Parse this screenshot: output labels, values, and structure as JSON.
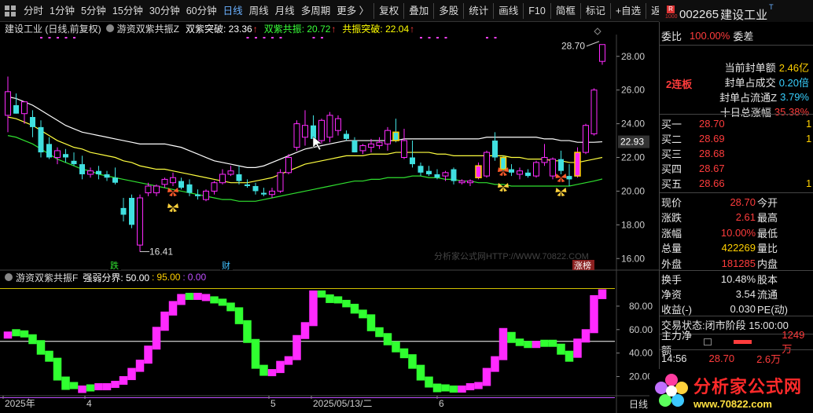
{
  "toolbar": {
    "periods": [
      "分时",
      "1分钟",
      "5分钟",
      "15分钟",
      "30分钟",
      "60分钟",
      "日线",
      "周线",
      "月线",
      "多周期",
      "更多 〉"
    ],
    "active_period": "日线",
    "tools": [
      "复权",
      "叠加",
      "多股",
      "统计",
      "画线",
      "F10",
      "简框",
      "标记",
      "+自选",
      "返回"
    ]
  },
  "stock": {
    "code": "002265",
    "name": "建设工业",
    "suffix": "T"
  },
  "price_header": {
    "title": "建设工业 (日线,前复权)",
    "indicator": "游资双紫共振Z",
    "items": [
      {
        "label": "双紫突破: 23.36",
        "color": "#ffffff"
      },
      {
        "label": "双紫共振: 20.72",
        "color": "#39ff39"
      },
      {
        "label": "共振突破: 22.04",
        "color": "#ffff00"
      }
    ]
  },
  "indicator_header": {
    "name": "游资双紫共振F",
    "label": "强弱分界: 50.00",
    "v2": "95.00",
    "v3": "0.00"
  },
  "chart_data": {
    "type": "candlestick",
    "y_axis_price": [
      16.0,
      18.0,
      20.0,
      22.0,
      24.0,
      26.0,
      28.0
    ],
    "current_price_label": "22.93",
    "high_label": "28.70",
    "low_label": "16.41",
    "ylim": [
      15.5,
      29.2
    ],
    "candles": [
      {
        "o": 24.5,
        "h": 26.8,
        "l": 23.5,
        "c": 25.9
      },
      {
        "o": 25.1,
        "h": 25.8,
        "l": 24.6,
        "c": 24.6
      },
      {
        "o": 24.6,
        "h": 25.3,
        "l": 24.0,
        "c": 25.3
      },
      {
        "o": 24.4,
        "h": 24.8,
        "l": 23.2,
        "c": 23.8
      },
      {
        "o": 23.8,
        "h": 24.2,
        "l": 22.0,
        "c": 22.3
      },
      {
        "o": 22.8,
        "h": 23.2,
        "l": 21.9,
        "c": 22.0
      },
      {
        "o": 22.0,
        "h": 22.6,
        "l": 21.6,
        "c": 22.4
      },
      {
        "o": 22.2,
        "h": 22.5,
        "l": 21.7,
        "c": 22.0
      },
      {
        "o": 21.8,
        "h": 22.3,
        "l": 21.5,
        "c": 21.6
      },
      {
        "o": 21.6,
        "h": 22.1,
        "l": 20.7,
        "c": 21.0
      },
      {
        "o": 21.0,
        "h": 21.4,
        "l": 20.8,
        "c": 21.2
      },
      {
        "o": 21.2,
        "h": 21.5,
        "l": 20.7,
        "c": 21.0
      },
      {
        "o": 21.0,
        "h": 21.2,
        "l": 20.6,
        "c": 20.8
      },
      {
        "o": 20.8,
        "h": 21.4,
        "l": 20.4,
        "c": 20.5
      },
      {
        "o": 19.0,
        "h": 19.6,
        "l": 18.2,
        "c": 18.6
      },
      {
        "o": 19.6,
        "h": 19.8,
        "l": 17.8,
        "c": 18.0
      },
      {
        "o": 16.8,
        "h": 19.8,
        "l": 16.4,
        "c": 19.6
      },
      {
        "o": 19.9,
        "h": 20.5,
        "l": 19.7,
        "c": 20.3
      },
      {
        "o": 19.9,
        "h": 20.4,
        "l": 19.7,
        "c": 20.3
      },
      {
        "o": 20.4,
        "h": 20.8,
        "l": 20.2,
        "c": 20.7
      },
      {
        "o": 20.5,
        "h": 21.1,
        "l": 20.3,
        "c": 20.8
      },
      {
        "o": 20.6,
        "h": 20.8,
        "l": 20.1,
        "c": 20.2
      },
      {
        "o": 20.4,
        "h": 20.7,
        "l": 19.7,
        "c": 19.9
      },
      {
        "o": 19.8,
        "h": 20.1,
        "l": 19.5,
        "c": 19.7
      },
      {
        "o": 19.5,
        "h": 20.1,
        "l": 19.4,
        "c": 20.0
      },
      {
        "o": 20.0,
        "h": 20.6,
        "l": 19.8,
        "c": 20.5
      },
      {
        "o": 20.5,
        "h": 21.3,
        "l": 20.4,
        "c": 21.0
      },
      {
        "o": 21.0,
        "h": 21.5,
        "l": 20.9,
        "c": 21.2
      },
      {
        "o": 21.0,
        "h": 21.5,
        "l": 20.4,
        "c": 20.6
      },
      {
        "o": 20.4,
        "h": 20.7,
        "l": 20.2,
        "c": 20.3
      },
      {
        "o": 20.3,
        "h": 20.5,
        "l": 19.8,
        "c": 20.0
      },
      {
        "o": 19.9,
        "h": 20.2,
        "l": 19.7,
        "c": 19.8
      },
      {
        "o": 19.8,
        "h": 20.2,
        "l": 19.6,
        "c": 20.0
      },
      {
        "o": 20.0,
        "h": 21.3,
        "l": 19.9,
        "c": 21.1
      },
      {
        "o": 21.1,
        "h": 22.2,
        "l": 21.0,
        "c": 22.0
      },
      {
        "o": 22.6,
        "h": 24.2,
        "l": 22.4,
        "c": 24.0
      },
      {
        "o": 23.2,
        "h": 24.8,
        "l": 22.7,
        "c": 23.9
      },
      {
        "o": 23.9,
        "h": 24.5,
        "l": 23.0,
        "c": 23.1
      },
      {
        "o": 23.0,
        "h": 24.3,
        "l": 22.8,
        "c": 24.2
      },
      {
        "o": 23.2,
        "h": 24.7,
        "l": 22.9,
        "c": 24.5
      },
      {
        "o": 23.6,
        "h": 24.5,
        "l": 23.3,
        "c": 24.3
      },
      {
        "o": 23.4,
        "h": 23.6,
        "l": 23.0,
        "c": 23.1
      },
      {
        "o": 23.0,
        "h": 23.2,
        "l": 22.3,
        "c": 22.3
      },
      {
        "o": 22.4,
        "h": 22.8,
        "l": 22.2,
        "c": 22.7
      },
      {
        "o": 22.6,
        "h": 23.1,
        "l": 22.3,
        "c": 22.8
      },
      {
        "o": 22.7,
        "h": 23.2,
        "l": 22.5,
        "c": 22.9
      },
      {
        "o": 22.8,
        "h": 23.8,
        "l": 22.4,
        "c": 23.6
      },
      {
        "o": 23.5,
        "h": 24.3,
        "l": 22.9,
        "c": 23.0
      },
      {
        "o": 22.0,
        "h": 23.7,
        "l": 21.9,
        "c": 23.0
      },
      {
        "o": 22.0,
        "h": 23.0,
        "l": 21.4,
        "c": 21.6
      },
      {
        "o": 21.5,
        "h": 21.7,
        "l": 20.9,
        "c": 21.1
      },
      {
        "o": 21.2,
        "h": 21.5,
        "l": 20.9,
        "c": 21.0
      },
      {
        "o": 21.0,
        "h": 21.3,
        "l": 20.7,
        "c": 20.8
      },
      {
        "o": 20.9,
        "h": 21.2,
        "l": 20.6,
        "c": 21.1
      },
      {
        "o": 21.3,
        "h": 21.4,
        "l": 20.4,
        "c": 20.6
      },
      {
        "o": 20.5,
        "h": 20.7,
        "l": 20.4,
        "c": 20.6
      },
      {
        "o": 20.5,
        "h": 20.7,
        "l": 20.3,
        "c": 20.6
      },
      {
        "o": 20.8,
        "h": 21.7,
        "l": 20.7,
        "c": 21.5
      },
      {
        "o": 20.9,
        "h": 22.4,
        "l": 20.8,
        "c": 22.3
      },
      {
        "o": 23.0,
        "h": 23.5,
        "l": 21.8,
        "c": 22.0
      },
      {
        "o": 22.0,
        "h": 22.1,
        "l": 21.2,
        "c": 21.3
      },
      {
        "o": 21.3,
        "h": 21.6,
        "l": 20.9,
        "c": 21.1
      },
      {
        "o": 21.0,
        "h": 21.4,
        "l": 20.7,
        "c": 21.2
      },
      {
        "o": 21.1,
        "h": 21.3,
        "l": 20.8,
        "c": 20.9
      },
      {
        "o": 20.9,
        "h": 21.8,
        "l": 20.8,
        "c": 21.7
      },
      {
        "o": 21.7,
        "h": 22.8,
        "l": 21.5,
        "c": 22.0
      },
      {
        "o": 20.9,
        "h": 22.0,
        "l": 20.7,
        "c": 21.9
      },
      {
        "o": 21.9,
        "h": 22.4,
        "l": 21.0,
        "c": 21.2
      },
      {
        "o": 20.9,
        "h": 21.6,
        "l": 20.3,
        "c": 20.7
      },
      {
        "o": 20.9,
        "h": 22.6,
        "l": 20.8,
        "c": 22.3
      },
      {
        "o": 22.3,
        "h": 24.0,
        "l": 22.2,
        "c": 23.9
      },
      {
        "o": 23.4,
        "h": 26.1,
        "l": 23.3,
        "c": 26.0
      },
      {
        "o": 27.7,
        "h": 28.7,
        "l": 27.5,
        "c": 28.7
      }
    ],
    "ma_white": [
      25.6,
      25.5,
      25.3,
      25.1,
      24.8,
      24.5,
      24.2,
      23.9,
      23.7,
      23.5,
      23.4,
      23.3,
      23.2,
      23.1,
      23.0,
      22.9,
      22.8,
      22.8,
      22.8,
      22.8,
      22.7,
      22.6,
      22.4,
      22.2,
      22.0,
      21.8,
      21.7,
      21.6,
      21.5,
      21.4,
      21.4,
      21.5,
      21.7,
      21.9,
      22.1,
      22.3,
      22.5,
      22.6,
      22.7,
      22.8,
      22.9,
      23.0,
      23.0,
      23.0,
      23.0,
      23.0,
      23.0,
      23.0,
      23.1,
      23.1,
      23.1,
      23.1,
      23.1,
      23.1,
      23.1,
      23.1,
      23.1,
      23.1,
      23.2,
      23.2,
      23.2,
      23.2,
      23.2,
      23.2,
      23.2,
      23.1,
      23.1,
      23.0,
      23.0,
      22.9,
      22.9,
      22.9,
      22.93
    ],
    "ma_yellow": [
      24.4,
      24.3,
      24.1,
      23.9,
      23.6,
      23.3,
      23.0,
      22.8,
      22.6,
      22.5,
      22.3,
      22.2,
      22.1,
      22.0,
      21.8,
      21.7,
      21.5,
      21.4,
      21.3,
      21.3,
      21.2,
      21.1,
      21.0,
      20.9,
      20.8,
      20.7,
      20.6,
      20.5,
      20.5,
      20.5,
      20.6,
      20.7,
      20.8,
      21.0,
      21.2,
      21.4,
      21.6,
      21.7,
      21.8,
      21.9,
      22.0,
      22.1,
      22.1,
      22.1,
      22.2,
      22.2,
      22.2,
      22.3,
      22.3,
      22.3,
      22.3,
      22.3,
      22.2,
      22.2,
      22.1,
      22.1,
      22.1,
      22.1,
      22.1,
      22.1,
      22.1,
      22.0,
      22.0,
      21.9,
      21.9,
      21.9,
      21.8,
      21.8,
      21.7,
      21.7,
      21.8,
      21.9,
      22.0
    ],
    "ma_green": [
      23.3,
      23.2,
      23.0,
      22.8,
      22.5,
      22.2,
      21.9,
      21.7,
      21.5,
      21.3,
      21.2,
      21.0,
      20.9,
      20.8,
      20.7,
      20.6,
      20.5,
      20.4,
      20.3,
      20.2,
      20.1,
      20.0,
      19.9,
      19.8,
      19.7,
      19.6,
      19.5,
      19.5,
      19.4,
      19.4,
      19.4,
      19.5,
      19.6,
      19.7,
      19.8,
      19.9,
      20.0,
      20.1,
      20.2,
      20.3,
      20.4,
      20.5,
      20.6,
      20.6,
      20.7,
      20.7,
      20.8,
      20.8,
      20.8,
      20.9,
      20.9,
      20.8,
      20.8,
      20.7,
      20.7,
      20.6,
      20.6,
      20.5,
      20.5,
      20.4,
      20.4,
      20.3,
      20.3,
      20.3,
      20.3,
      20.3,
      20.3,
      20.3,
      20.3,
      20.4,
      20.5,
      20.6,
      20.72
    ],
    "bottom_labels": {
      "die": "跌",
      "cai": "财",
      "zhangbang": "涨榜"
    },
    "watermark": "分析家公式网HTTP://WWW.70822.COM",
    "indicator": {
      "ylim": [
        5,
        100
      ],
      "y_axis": [
        20.0,
        40.0,
        60.0,
        80.0
      ],
      "upper": 95.0,
      "mid": 50.0,
      "lower": 0.0,
      "values": [
        55,
        57,
        56,
        51,
        42,
        36,
        20,
        12,
        12,
        9,
        10,
        11,
        11,
        13,
        17,
        24,
        31,
        43,
        59,
        72,
        81,
        87,
        88,
        88,
        87,
        85,
        83,
        79,
        68,
        52,
        30,
        24,
        23,
        30,
        34,
        52,
        63,
        90,
        90,
        86,
        85,
        82,
        77,
        73,
        62,
        57,
        50,
        44,
        39,
        30,
        20,
        14,
        10,
        10,
        9,
        9,
        11,
        12,
        24,
        34,
        58,
        52,
        49,
        47,
        47,
        48,
        48,
        42,
        36,
        49,
        57,
        86,
        91
      ],
      "colors": [
        "m",
        "g",
        "g",
        "g",
        "g",
        "g",
        "g",
        "g",
        "g",
        "m",
        "g",
        "m",
        "m",
        "m",
        "m",
        "m",
        "m",
        "m",
        "m",
        "m",
        "m",
        "m",
        "g",
        "m",
        "m",
        "g",
        "g",
        "g",
        "g",
        "g",
        "g",
        "g",
        "m",
        "m",
        "m",
        "m",
        "m",
        "m",
        "g",
        "g",
        "g",
        "g",
        "g",
        "g",
        "g",
        "g",
        "g",
        "g",
        "g",
        "g",
        "g",
        "g",
        "g",
        "g",
        "g",
        "m",
        "m",
        "m",
        "m",
        "m",
        "m",
        "g",
        "g",
        "g",
        "m",
        "g",
        "g",
        "g",
        "g",
        "m",
        "m",
        "m",
        "m"
      ]
    },
    "x_labels": [
      "2025年",
      "4",
      "5",
      "2025/05/13/二",
      "6"
    ]
  },
  "panel": {
    "weibi_label": "委比",
    "weibi_val": "100.00%",
    "weicha_label": "委差",
    "lianban": "2连板",
    "feng": [
      {
        "label": "当前封单额",
        "val": "2.46亿"
      },
      {
        "label": "封单占成交",
        "val": "0.20倍"
      },
      {
        "label": "封单占流通Z",
        "val": "3.79%"
      },
      {
        "label": "十日总涨幅",
        "val": "35.38%"
      }
    ],
    "book": [
      {
        "label": "买一",
        "price": "28.70",
        "mark": "1"
      },
      {
        "label": "买二",
        "price": "28.69",
        "mark": "1"
      },
      {
        "label": "买三",
        "price": "28.68",
        "mark": ""
      },
      {
        "label": "买四",
        "price": "28.67",
        "mark": ""
      },
      {
        "label": "买五",
        "price": "28.66",
        "mark": "1"
      }
    ],
    "quote": [
      {
        "l": "现价",
        "v": "28.70",
        "r": "今开"
      },
      {
        "l": "涨跌",
        "v": "2.61",
        "r": "最高"
      },
      {
        "l": "涨幅",
        "v": "10.00%",
        "r": "最低"
      },
      {
        "l": "总量",
        "v": "422269",
        "r": "量比"
      },
      {
        "l": "外盘",
        "v": "181285",
        "r": "内盘"
      },
      {
        "l": "换手",
        "v": "10.48%",
        "r": "股本"
      },
      {
        "l": "净资",
        "v": "3.54",
        "r": "流通"
      },
      {
        "l": "收益(-)",
        "v": "0.030",
        "r": "PE(动)"
      }
    ],
    "status_label": "交易状态:",
    "status_val": "闭市阶段 15:00:00",
    "capital_label": "主力净额",
    "capital_val": "1249万",
    "tick_time": "14:56",
    "tick_price": "28.70",
    "tick_vol": "2.6万",
    "period_tab": "日线"
  },
  "logo": {
    "main": "分析家公式网",
    "sub": "www.70822.com"
  }
}
